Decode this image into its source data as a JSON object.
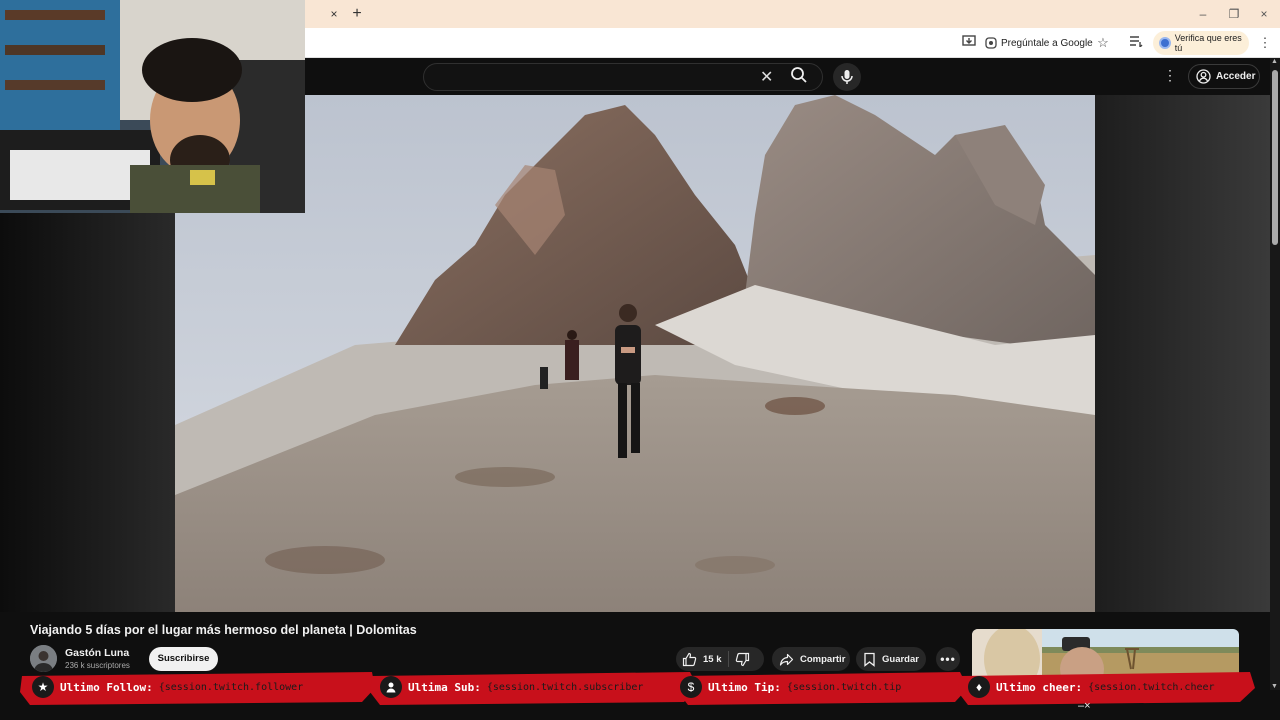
{
  "browser": {
    "tab_close": "×",
    "new_tab": "+",
    "window_controls": {
      "minimize": "–",
      "restore": "❐",
      "close": "×"
    },
    "ask_google": "Pregúntale a Google",
    "verify": "Verifica que eres tú"
  },
  "youtube": {
    "search_placeholder": "",
    "sign_in": "Acceder"
  },
  "video": {
    "title": "Viajando 5 días por el lugar más hermoso del planeta | Dolomitas",
    "channel": "Gastón Luna",
    "subscribers": "236 k suscriptores",
    "subscribe": "Suscribirse",
    "likes": "15 k",
    "share": "Compartir",
    "save": "Guardar"
  },
  "overlay": {
    "follow_label": "Ultimo Follow:",
    "follow_value": "{session.twitch.follower",
    "sub_label": "Ultima Sub:",
    "sub_value": "{session.twitch.subscriber",
    "tip_label": "Ultimo Tip:",
    "tip_value": "{session.twitch.tip",
    "cheer_label": "Ultimo cheer:",
    "cheer_value": "{session.twitch.cheer"
  },
  "colors": {
    "overlay_red": "#c8101b",
    "youtube_bg": "#0f0f0f",
    "tab_bar": "#f9e6d4"
  }
}
